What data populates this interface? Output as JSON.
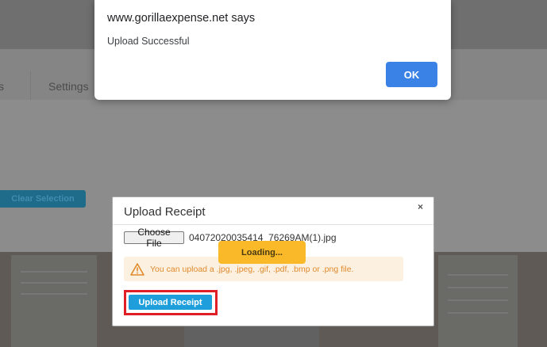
{
  "background": {
    "nav_partial": "s",
    "nav_settings": "Settings",
    "clear_selection": "Clear Selection"
  },
  "alert": {
    "title": "www.gorillaexpense.net says",
    "message": "Upload Successful",
    "ok_label": "OK"
  },
  "modal": {
    "title": "Upload Receipt",
    "close_symbol": "×",
    "choose_file_label": "Choose File",
    "file_name": "04072020035414_76269AM(1).jpg",
    "loading_text": "Loading...",
    "warning_text": "You can upload a .jpg, .jpeg, .gif, .pdf, .bmp or .png file.",
    "upload_button_label": "Upload Receipt"
  },
  "colors": {
    "accent_blue": "#1e9fdc",
    "alert_ok_blue": "#3b82e6",
    "loading_yellow": "#f9b929",
    "warning_orange": "#e08a2c",
    "highlight_red": "#e01e25"
  },
  "icons": {
    "warning": "warning-triangle-icon"
  }
}
